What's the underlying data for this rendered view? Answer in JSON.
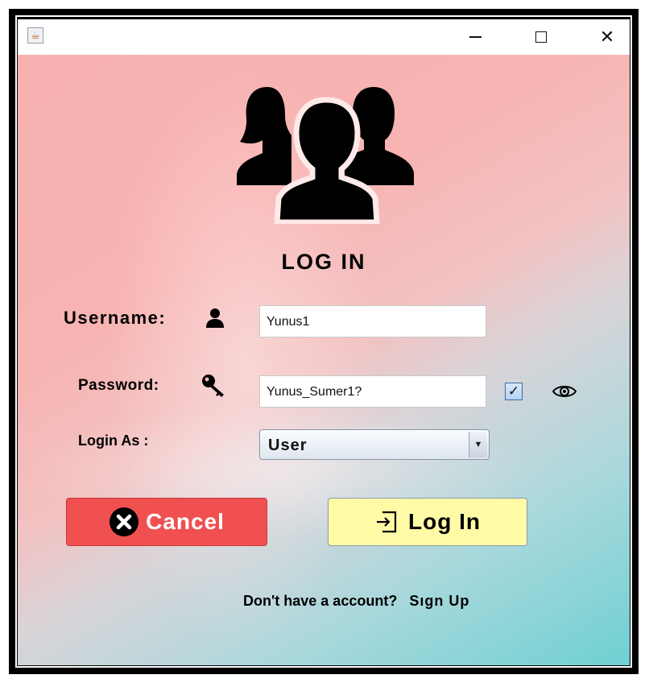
{
  "window": {
    "title": "",
    "app_icon": "java-cup-icon",
    "controls": [
      "minimize",
      "maximize",
      "close"
    ],
    "close_glyph": "✕"
  },
  "form": {
    "heading": "LOG IN",
    "username_label": "Username:",
    "username_value": "Yunus1",
    "password_label": "Password:",
    "password_value": "Yunus_Sumer1?",
    "show_password_checked": true,
    "checkbox_glyph": "✓",
    "login_as_label": "Login As :",
    "login_as_value": "User",
    "select_arrow": "▼"
  },
  "buttons": {
    "cancel_label": "Cancel",
    "login_label": "Log In"
  },
  "footer": {
    "prompt": "Don't have a account?",
    "signup_label": "Sıgn Up"
  },
  "colors": {
    "cancel_bg": "#f05050",
    "login_bg": "#fffaa6",
    "bg_top": "#f6b0b0",
    "bg_bottom": "#6fd0d2"
  }
}
